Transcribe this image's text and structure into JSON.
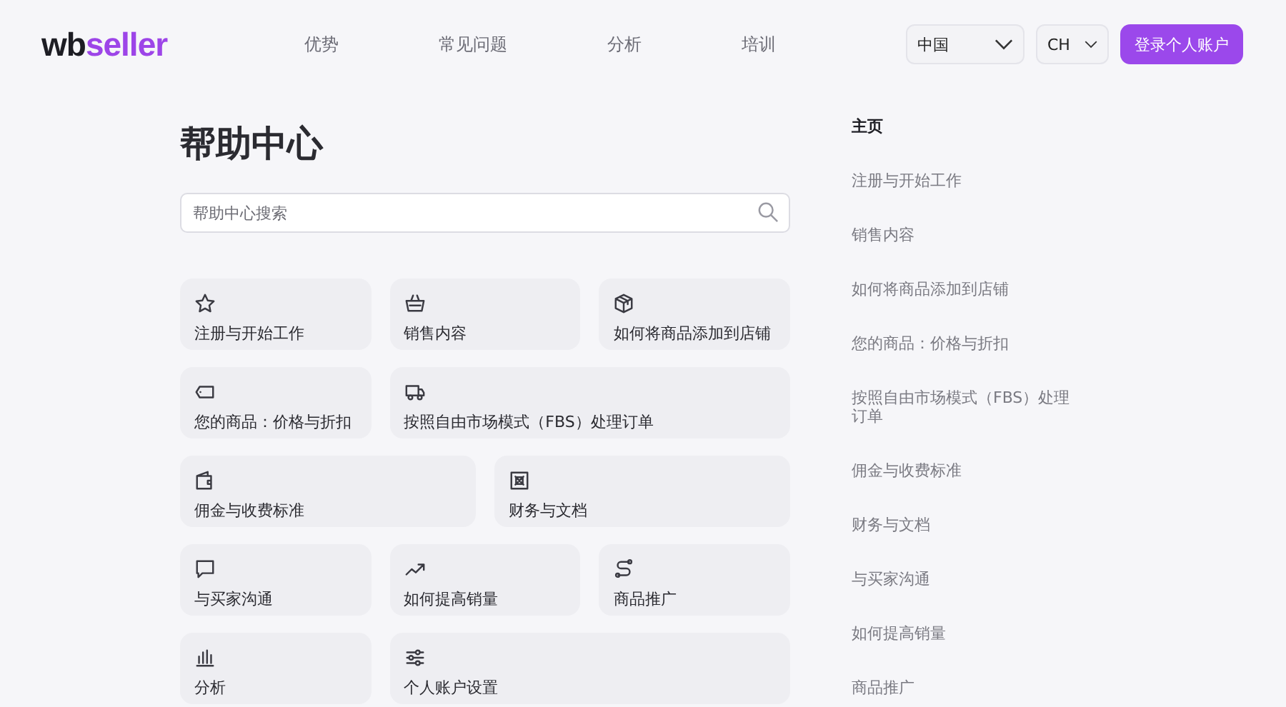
{
  "header": {
    "logo": {
      "part_1": "wb",
      "part_2": "seller"
    },
    "nav": [
      {
        "label": "优势"
      },
      {
        "label": "常见问题"
      },
      {
        "label": "分析"
      },
      {
        "label": "培训"
      }
    ],
    "region_select": {
      "value": "中国"
    },
    "language_select": {
      "value": "CH"
    },
    "login_button": {
      "label": "登录个人账户"
    }
  },
  "main": {
    "title": "帮助中心",
    "search": {
      "placeholder": "帮助中心搜索"
    },
    "cards": [
      {
        "label": "注册与开始工作"
      },
      {
        "label": "销售内容"
      },
      {
        "label": "如何将商品添加到店铺"
      },
      {
        "label": "您的商品：价格与折扣"
      },
      {
        "label": "按照自由市场模式（FBS）处理订单"
      },
      {
        "label": "佣金与收费标准"
      },
      {
        "label": "财务与文档"
      },
      {
        "label": "与买家沟通"
      },
      {
        "label": "如何提高销量"
      },
      {
        "label": "商品推广"
      },
      {
        "label": "分析"
      },
      {
        "label": "个人账户设置"
      }
    ]
  },
  "sidebar": {
    "items": [
      {
        "label": "主页",
        "selected": true
      },
      {
        "label": "注册与开始工作",
        "selected": false
      },
      {
        "label": "销售内容",
        "selected": false
      },
      {
        "label": "如何将商品添加到店铺",
        "selected": false
      },
      {
        "label": "您的商品：价格与折扣",
        "selected": false
      },
      {
        "label": "按照自由市场模式（FBS）处理订单",
        "selected": false
      },
      {
        "label": "佣金与收费标准",
        "selected": false
      },
      {
        "label": "财务与文档",
        "selected": false
      },
      {
        "label": "与买家沟通",
        "selected": false
      },
      {
        "label": "如何提高销量",
        "selected": false
      },
      {
        "label": "商品推广",
        "selected": false
      }
    ]
  }
}
